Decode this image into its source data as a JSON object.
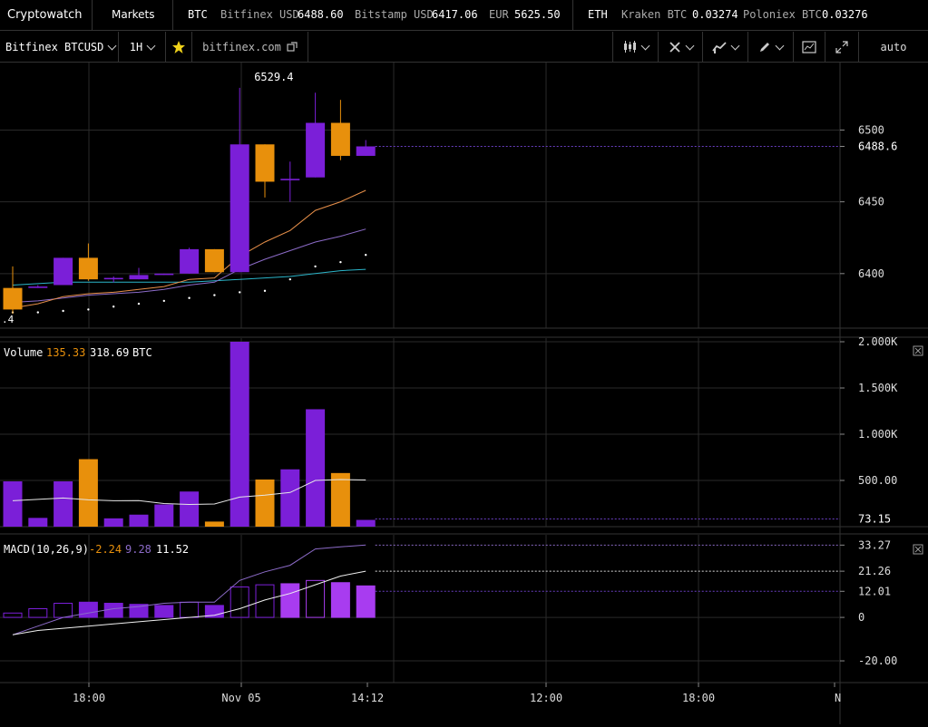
{
  "header": {
    "brand": "Cryptowatch",
    "markets": "Markets",
    "btc_label": "BTC",
    "tickers_btc": [
      {
        "name": "Bitfinex USD",
        "price": "6488.60"
      },
      {
        "name": "Bitstamp USD",
        "price": "6417.06"
      },
      {
        "name": "EUR",
        "price": "5625.50"
      }
    ],
    "eth_label": "ETH",
    "tickers_eth": [
      {
        "name": "Kraken BTC",
        "price": "0.03274"
      },
      {
        "name": "Poloniex BTC",
        "price": "0.03276"
      }
    ]
  },
  "toolbar": {
    "market": "Bitfinex BTCUSD",
    "interval": "1H",
    "star_icon": "star-icon",
    "exchange_link": "bitfinex.com",
    "external_icon": "external-link-icon",
    "tools": [
      "candlestick-icon",
      "crosshair-icon",
      "indicators-icon",
      "pencil-icon",
      "screenshot-icon",
      "fullscreen-icon"
    ],
    "scale": "auto"
  },
  "colors": {
    "bull": "#7b1fd8",
    "bear": "#e8900c",
    "grid": "#2a2a2a",
    "ema_fast": "#e8904a",
    "ema_slow": "#8c6bc8",
    "sma": "#2bb5c9",
    "last_price_line": "#6a3fc4",
    "macd_bright": "#a83cf0"
  },
  "chart_data": [
    {
      "type": "candlestick",
      "panel": "price",
      "title": "Bitfinex BTCUSD 1H",
      "y_ticks": [
        "6500",
        "6450",
        "6400"
      ],
      "last_price": "6488.6",
      "high_annotation": "6529.4",
      "low_annotation_partial": ".4",
      "x_ticks": [
        "18:00",
        "Nov 05",
        "14:12",
        "12:00",
        "18:00",
        "N"
      ],
      "candles": [
        {
          "o": 6390,
          "h": 6405,
          "l": 6372,
          "c": 6375
        },
        {
          "o": 6390,
          "h": 6392,
          "l": 6390,
          "c": 6391
        },
        {
          "o": 6392,
          "h": 6411,
          "l": 6392,
          "c": 6411
        },
        {
          "o": 6411,
          "h": 6421,
          "l": 6395,
          "c": 6396
        },
        {
          "o": 6396,
          "h": 6398,
          "l": 6394,
          "c": 6397
        },
        {
          "o": 6396,
          "h": 6404,
          "l": 6396,
          "c": 6399
        },
        {
          "o": 6399,
          "h": 6400,
          "l": 6399,
          "c": 6400
        },
        {
          "o": 6400,
          "h": 6418,
          "l": 6400,
          "c": 6417
        },
        {
          "o": 6417,
          "h": 6417,
          "l": 6401,
          "c": 6401
        },
        {
          "o": 6401,
          "h": 6529.4,
          "l": 6401,
          "c": 6490
        },
        {
          "o": 6490,
          "h": 6490,
          "l": 6453,
          "c": 6464
        },
        {
          "o": 6465,
          "h": 6478,
          "l": 6450,
          "c": 6466
        },
        {
          "o": 6467,
          "h": 6526,
          "l": 6467,
          "c": 6505
        },
        {
          "o": 6505,
          "h": 6521,
          "l": 6479,
          "c": 6482
        },
        {
          "o": 6482,
          "h": 6493,
          "l": 6482,
          "c": 6488.6
        }
      ],
      "ema_fast": [
        6376,
        6379,
        6384,
        6386,
        6387,
        6389,
        6391,
        6396,
        6397,
        6412,
        6422,
        6430,
        6444,
        6450,
        6458
      ],
      "ema_slow": [
        6380,
        6381,
        6383,
        6385,
        6386,
        6387,
        6389,
        6392,
        6394,
        6403,
        6410,
        6416,
        6422,
        6426,
        6431
      ],
      "sma": [
        6392,
        6393,
        6394,
        6394,
        6394,
        6394,
        6394,
        6394,
        6395,
        6396,
        6397,
        6398,
        6400,
        6402,
        6403
      ],
      "sar": [
        6373,
        6373,
        6374,
        6375,
        6377,
        6379,
        6381,
        6383,
        6385,
        6387,
        6388,
        6396,
        6405,
        6408,
        6413
      ]
    },
    {
      "type": "bar",
      "panel": "volume",
      "label": "Volume",
      "value_current": "135.33",
      "value_avg": "318.69",
      "unit": "BTC",
      "y_ticks": [
        "2.000K",
        "1.500K",
        "1.000K",
        "500.00"
      ],
      "last_value_label": "73.15",
      "values": [
        490,
        95,
        490,
        730,
        90,
        130,
        240,
        380,
        55,
        2000,
        510,
        620,
        1270,
        580,
        73.15
      ],
      "directions": [
        "bull",
        "bull",
        "bull",
        "bear",
        "bull",
        "bull",
        "bull",
        "bull",
        "bear",
        "bull",
        "bear",
        "bull",
        "bull",
        "bear",
        "bull"
      ],
      "sma": [
        280,
        295,
        310,
        290,
        280,
        282,
        250,
        240,
        245,
        320,
        340,
        370,
        500,
        510,
        505
      ]
    },
    {
      "type": "bar",
      "panel": "macd",
      "label": "MACD(10,26,9)",
      "macd_value": "-2.24",
      "signal_value": "9.28",
      "hist_value": "11.52",
      "y_ticks": [
        "33.27",
        "21.26",
        "12.01",
        "0",
        "-20.00"
      ],
      "histogram": [
        2,
        4,
        6.5,
        7,
        6.5,
        6,
        5.5,
        7,
        5.5,
        14,
        15,
        15.5,
        17,
        16,
        14.5
      ],
      "histogram_style": [
        "hollow",
        "hollow",
        "hollow",
        "filled",
        "filled",
        "filled",
        "filled",
        "hollow",
        "filled",
        "hollow",
        "hollow",
        "filled",
        "hollow",
        "filled",
        "filled"
      ],
      "macd_line": [
        -8,
        -4,
        0,
        2,
        4,
        5,
        6.5,
        7,
        7,
        17,
        21,
        24,
        31.5,
        32.5,
        33.27
      ],
      "signal_line": [
        -8,
        -6,
        -5,
        -4,
        -3,
        -2,
        -1,
        0,
        1,
        4,
        8,
        11,
        15,
        19,
        21.26
      ]
    }
  ]
}
